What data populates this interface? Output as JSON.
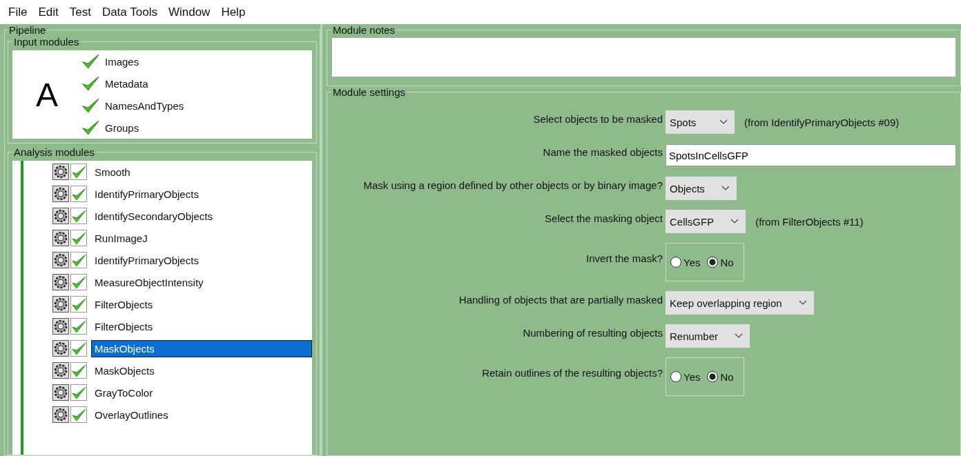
{
  "menu": [
    "File",
    "Edit",
    "Test",
    "Data Tools",
    "Window",
    "Help"
  ],
  "pipeline": {
    "title": "Pipeline",
    "panel_label": "A",
    "input_modules": {
      "title": "Input modules",
      "items": [
        "Images",
        "Metadata",
        "NamesAndTypes",
        "Groups"
      ]
    },
    "analysis_modules": {
      "title": "Analysis modules",
      "items": [
        {
          "name": "Smooth",
          "selected": false
        },
        {
          "name": "IdentifyPrimaryObjects",
          "selected": false
        },
        {
          "name": "IdentifySecondaryObjects",
          "selected": false
        },
        {
          "name": "RunImageJ",
          "selected": false
        },
        {
          "name": "IdentifyPrimaryObjects",
          "selected": false
        },
        {
          "name": "MeasureObjectIntensity",
          "selected": false
        },
        {
          "name": "FilterObjects",
          "selected": false
        },
        {
          "name": "FilterObjects",
          "selected": false
        },
        {
          "name": "MaskObjects",
          "selected": true
        },
        {
          "name": "MaskObjects",
          "selected": false
        },
        {
          "name": "GrayToColor",
          "selected": false
        },
        {
          "name": "OverlayOutlines",
          "selected": false
        }
      ]
    }
  },
  "module_notes": {
    "title": "Module notes"
  },
  "module_settings": {
    "title": "Module settings",
    "settings": [
      {
        "kind": "dropdown",
        "label": "Select objects to be masked",
        "value": "Spots",
        "note": "(from IdentifyPrimaryObjects #09)"
      },
      {
        "kind": "text",
        "label": "Name the masked objects",
        "value": "SpotsInCellsGFP"
      },
      {
        "kind": "dropdown",
        "label": "Mask using a region defined by other objects or by binary image?",
        "value": "Objects"
      },
      {
        "kind": "dropdown",
        "label": "Select the masking object",
        "value": "CellsGFP",
        "note": "(from FilterObjects #11)"
      },
      {
        "kind": "radio",
        "label": "Invert the mask?",
        "options": [
          {
            "label": "Yes",
            "selected": false
          },
          {
            "label": "No",
            "selected": true
          }
        ]
      },
      {
        "kind": "dropdown",
        "label": "Handling of objects that are partially masked",
        "value": "Keep overlapping region"
      },
      {
        "kind": "dropdown",
        "label": "Numbering of resulting objects",
        "value": "Renumber"
      },
      {
        "kind": "radio",
        "label": "Retain outlines of the resulting objects?",
        "options": [
          {
            "label": "Yes",
            "selected": false
          },
          {
            "label": "No",
            "selected": true
          }
        ]
      }
    ]
  }
}
